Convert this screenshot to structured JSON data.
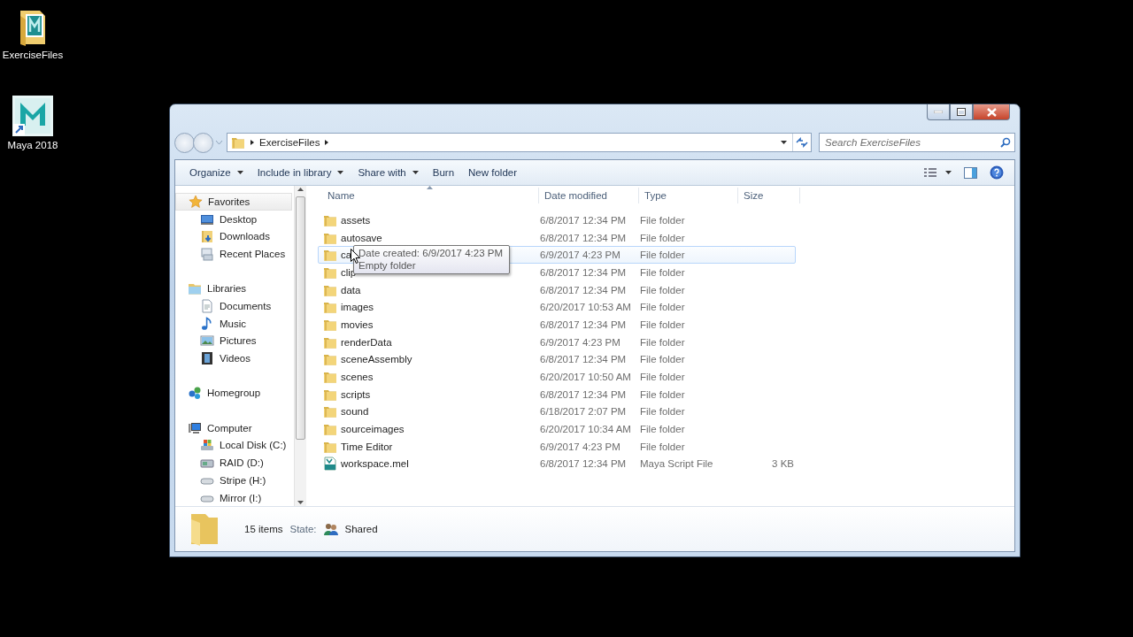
{
  "desktop_icons": [
    {
      "label": "ExerciseFiles",
      "kind": "folder"
    },
    {
      "label": "Maya 2018",
      "kind": "app"
    }
  ],
  "window": {
    "breadcrumb": [
      "ExerciseFiles"
    ],
    "search": {
      "placeholder": "Search ExerciseFiles"
    },
    "toolbar": [
      {
        "label": "Organize",
        "dropdown": true
      },
      {
        "label": "Include in library",
        "dropdown": true
      },
      {
        "label": "Share with",
        "dropdown": true
      },
      {
        "label": "Burn",
        "dropdown": false
      },
      {
        "label": "New folder",
        "dropdown": false
      }
    ],
    "sidebar": [
      {
        "label": "Favorites",
        "kind": "star",
        "selected": true,
        "children": [
          {
            "label": "Desktop",
            "kind": "desktop",
            "selected": false
          },
          {
            "label": "Downloads",
            "kind": "downloads",
            "selected": false
          },
          {
            "label": "Recent Places",
            "kind": "recent",
            "selected": false
          }
        ]
      },
      {
        "label": "Libraries",
        "kind": "library",
        "selected": false,
        "children": [
          {
            "label": "Documents",
            "kind": "document",
            "selected": false
          },
          {
            "label": "Music",
            "kind": "music",
            "selected": false
          },
          {
            "label": "Pictures",
            "kind": "pictures",
            "selected": false
          },
          {
            "label": "Videos",
            "kind": "videos",
            "selected": false
          }
        ]
      },
      {
        "label": "Homegroup",
        "kind": "homegroup",
        "selected": false
      },
      {
        "label": "Computer",
        "kind": "computer",
        "selected": false,
        "children": [
          {
            "label": "Local Disk (C:)",
            "kind": "system-drive",
            "selected": false
          },
          {
            "label": "RAID (D:)",
            "kind": "raid-drive",
            "selected": false
          },
          {
            "label": "Stripe (H:)",
            "kind": "drive",
            "selected": false
          },
          {
            "label": "Mirror (I:)",
            "kind": "drive",
            "selected": false
          }
        ]
      }
    ],
    "columns": [
      "Name",
      "Date modified",
      "Type",
      "Size"
    ],
    "rows": [
      {
        "name": "assets",
        "date": "6/8/2017 12:34 PM",
        "type": "File folder",
        "kind": "folder",
        "hovered": false
      },
      {
        "name": "autosave",
        "date": "6/8/2017 12:34 PM",
        "type": "File folder",
        "kind": "folder",
        "hovered": false
      },
      {
        "name": "ca",
        "date": "6/9/2017 4:23 PM",
        "type": "File folder",
        "kind": "folder",
        "hovered": true
      },
      {
        "name": "clip",
        "date": "6/8/2017 12:34 PM",
        "type": "File folder",
        "kind": "folder",
        "hovered": false
      },
      {
        "name": "data",
        "date": "6/8/2017 12:34 PM",
        "type": "File folder",
        "kind": "folder",
        "hovered": false
      },
      {
        "name": "images",
        "date": "6/20/2017 10:53 AM",
        "type": "File folder",
        "kind": "folder",
        "hovered": false
      },
      {
        "name": "movies",
        "date": "6/8/2017 12:34 PM",
        "type": "File folder",
        "kind": "folder",
        "hovered": false
      },
      {
        "name": "renderData",
        "date": "6/9/2017 4:23 PM",
        "type": "File folder",
        "kind": "folder",
        "hovered": false
      },
      {
        "name": "sceneAssembly",
        "date": "6/8/2017 12:34 PM",
        "type": "File folder",
        "kind": "folder",
        "hovered": false
      },
      {
        "name": "scenes",
        "date": "6/20/2017 10:50 AM",
        "type": "File folder",
        "kind": "folder",
        "hovered": false
      },
      {
        "name": "scripts",
        "date": "6/8/2017 12:34 PM",
        "type": "File folder",
        "kind": "folder",
        "hovered": false
      },
      {
        "name": "sound",
        "date": "6/18/2017 2:07 PM",
        "type": "File folder",
        "kind": "folder",
        "hovered": false
      },
      {
        "name": "sourceimages",
        "date": "6/20/2017 10:34 AM",
        "type": "File folder",
        "kind": "folder",
        "hovered": false
      },
      {
        "name": "Time Editor",
        "date": "6/9/2017 4:23 PM",
        "type": "File folder",
        "kind": "folder",
        "hovered": false
      },
      {
        "name": "workspace.mel",
        "date": "6/8/2017 12:34 PM",
        "type": "Maya Script File",
        "size": "3 KB",
        "kind": "script",
        "hovered": false
      }
    ],
    "tooltip": {
      "lines": [
        "Date created: 6/9/2017 4:23 PM",
        "Empty folder"
      ]
    },
    "status": {
      "count": "15 items",
      "state_label": "State:",
      "state": "Shared"
    }
  }
}
